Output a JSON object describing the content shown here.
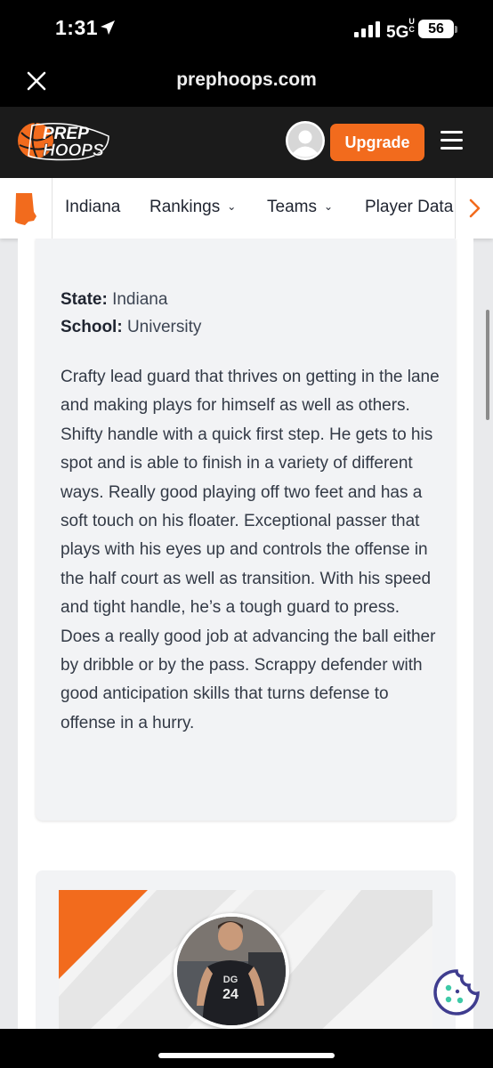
{
  "status_bar": {
    "time": "1:31",
    "network": "5G",
    "network_suffix": "UC",
    "battery": "56"
  },
  "browser": {
    "url": "prephoops.com"
  },
  "header": {
    "logo_top": "PREP",
    "logo_bottom": "HOOPS",
    "upgrade_label": "Upgrade"
  },
  "nav": {
    "items": [
      {
        "label": "Indiana",
        "has_dropdown": false
      },
      {
        "label": "Rankings",
        "has_dropdown": true
      },
      {
        "label": "Teams",
        "has_dropdown": true
      },
      {
        "label": "Player Data",
        "has_dropdown": false
      }
    ],
    "caret": "⌄",
    "more": "›"
  },
  "profile": {
    "state_label": "State:",
    "state_value": "Indiana",
    "school_label": "School:",
    "school_value": "University",
    "description": "Crafty lead guard that thrives on getting in the lane and making plays for himself as well as others. Shifty handle with a quick first step. He gets to his spot and is able to finish in a variety of different ways. Really good playing off two feet and has a soft touch on his floater. Exceptional passer that plays with his eyes up and controls the offense in the half court as well as transition. With his speed and tight handle, he’s a tough guard to press. Does a really good job at advancing the ball either by dribble or by the pass. Scrappy defender with good anticipation skills that turns defense to offense in a hurry."
  },
  "player_card": {
    "jersey_number": "24",
    "jersey_logo": "DG"
  },
  "colors": {
    "brand_orange": "#f26b1d",
    "header_dark": "#1b1b1b",
    "cookie_purple": "#3f3d8f",
    "cookie_teal": "#3ec9a7"
  },
  "icons": [
    "location-arrow-icon",
    "signal-icon",
    "close-icon",
    "avatar-icon",
    "menu-icon",
    "indiana-state-icon",
    "chevron-right-icon",
    "cookie-icon"
  ]
}
